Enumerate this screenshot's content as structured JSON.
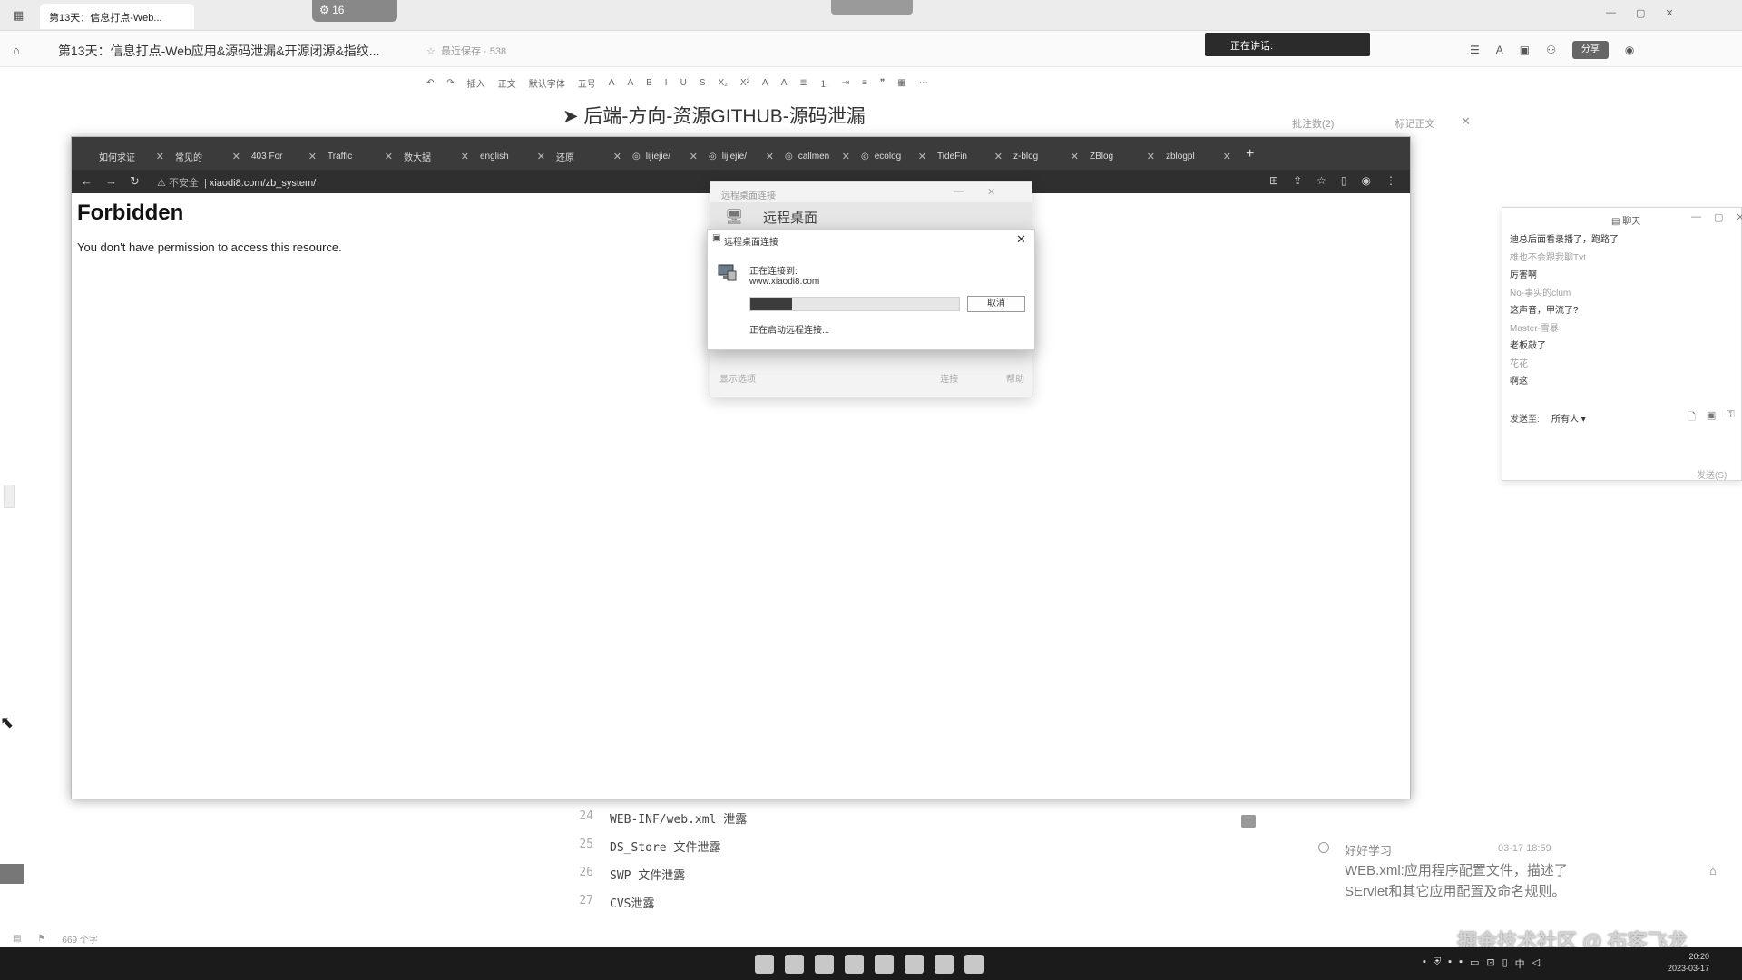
{
  "doc_app": {
    "tab_title": "第13天：信息打点-Web...",
    "meeting_counter": "16",
    "title": "第13天：信息打点-Web应用&源码泄漏&开源闭源&指纹...",
    "meta": "最近保存 · 538",
    "speaking": "正在讲话:",
    "share_label": "分享",
    "heading": "➤ 后端-方向-资源GITHUB-源码泄漏",
    "comments_header": "批注数(2)",
    "comments_tab": "标记正文",
    "toolbar": [
      "插入",
      "正文",
      "默认字体",
      "五号",
      "A",
      "A",
      "B",
      "I",
      "U",
      "S",
      "X₂",
      "X²",
      "A",
      "A"
    ],
    "status": [
      "669 个字"
    ]
  },
  "browser": {
    "tabs": [
      "如何求证",
      "常见的",
      "403 For",
      "Traffic",
      "数大据",
      "english",
      "还原",
      "lijiejie/",
      "lijiejie/",
      "callmen",
      "ecolog",
      "TideFin",
      "z-blog",
      "ZBlog",
      "zblogpl"
    ],
    "new_tab": "+",
    "url_warning": "不安全",
    "url": "xiaodi8.com/zb_system/",
    "page_title": "Forbidden",
    "page_message": "You don't have permission to access this resource."
  },
  "rdp_back": {
    "title": "远程桌面连接",
    "heading": "远程桌面",
    "footer_left": "显示选项",
    "footer_btn1": "连接",
    "footer_btn2": "帮助"
  },
  "rdp_dialog": {
    "title": "远程桌面连接",
    "connecting": "正在连接到:",
    "host": "www.xiaodi8.com",
    "progress": 0.2,
    "cancel": "取消",
    "status": "正在启动远程连接..."
  },
  "chat": {
    "title": "聊天",
    "messages": [
      {
        "text": "迪总后面看录播了，跑路了",
        "tone": "dark"
      },
      {
        "text": "雄也不会跟我聊Tvt",
        "tone": "light"
      },
      {
        "text": "厉害啊",
        "tone": "dark"
      },
      {
        "text": "No-事实的clum",
        "tone": "light"
      },
      {
        "text": "这声音，甲流了?",
        "tone": "dark"
      },
      {
        "text": "Master-雪暴",
        "tone": "light"
      },
      {
        "text": "老板敲了",
        "tone": "dark"
      },
      {
        "text": "花花",
        "tone": "light"
      },
      {
        "text": "啊这",
        "tone": "dark"
      }
    ],
    "send_to_label": "发送至:",
    "send_to_value": "所有人 ▾",
    "send_label": "发送(S)"
  },
  "doc_list": [
    {
      "num": "24",
      "text": "WEB-INF/web.xml 泄露"
    },
    {
      "num": "25",
      "text": "DS_Store 文件泄露"
    },
    {
      "num": "26",
      "text": "SWP 文件泄露"
    },
    {
      "num": "27",
      "text": "CVS泄露"
    }
  ],
  "comment": {
    "author": "好好学习",
    "time": "03-17 18:59",
    "text": "WEB.xml:应用程序配置文件，描述了SErvlet和其它应用配置及命名规则。"
  },
  "watermark": "掘金技术社区 @ 布客飞龙",
  "taskbar": {
    "clock_time": "20:20",
    "clock_date": "2023-03-17",
    "ime": "中"
  }
}
